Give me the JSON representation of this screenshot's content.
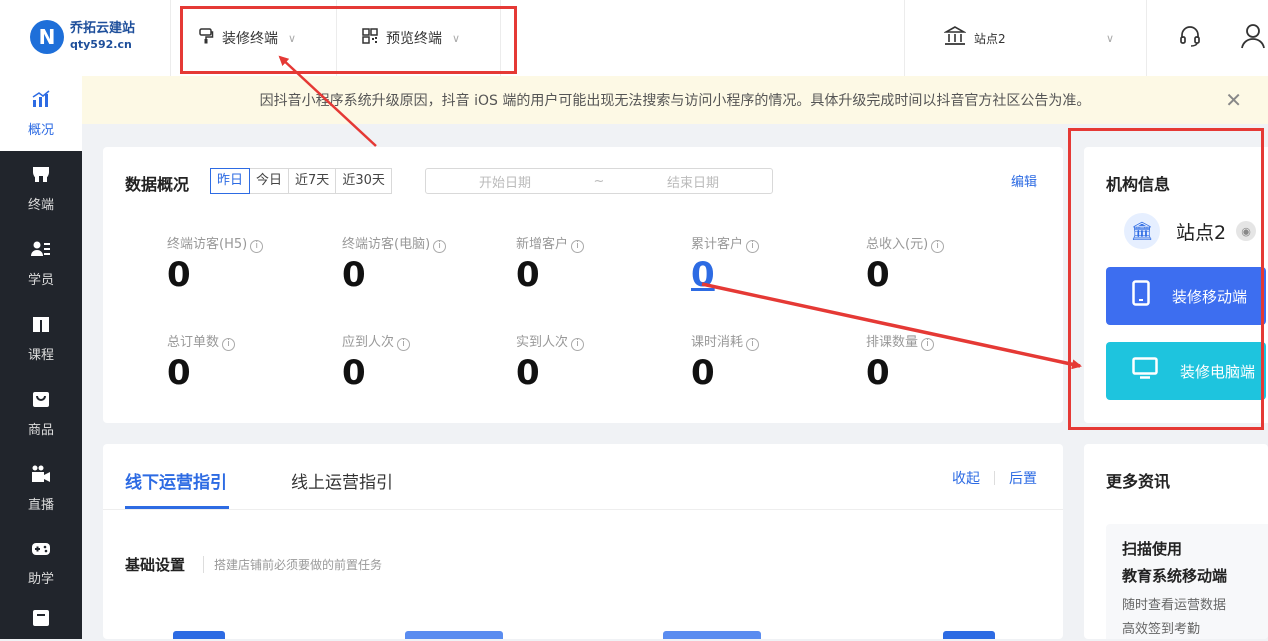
{
  "brand": {
    "name": "乔拓云建站",
    "domain": "qty592.cn"
  },
  "topnav": {
    "decorate_terminal": "装修终端",
    "preview_terminal": "预览终端",
    "site_selector": "站点2"
  },
  "sidebar": {
    "items": [
      {
        "label": "概况",
        "icon": "chart-icon"
      },
      {
        "label": "终端",
        "icon": "store-icon"
      },
      {
        "label": "学员",
        "icon": "students-icon"
      },
      {
        "label": "课程",
        "icon": "book-icon"
      },
      {
        "label": "商品",
        "icon": "bag-icon"
      },
      {
        "label": "直播",
        "icon": "video-icon"
      },
      {
        "label": "助学",
        "icon": "gamepad-icon"
      }
    ]
  },
  "notice": {
    "text": "因抖音小程序系统升级原因，抖音 iOS 端的用户可能出现无法搜索与访问小程序的情况。具体升级完成时间以抖音官方社区公告为准。"
  },
  "overview": {
    "title": "数据概况",
    "tabs": [
      "昨日",
      "今日",
      "近7天",
      "近30天"
    ],
    "active_tab": "昨日",
    "start_placeholder": "开始日期",
    "tilde": "~",
    "end_placeholder": "结束日期",
    "edit": "编辑",
    "metrics": [
      {
        "label": "终端访客(H5)",
        "value": "0"
      },
      {
        "label": "终端访客(电脑)",
        "value": "0"
      },
      {
        "label": "新增客户",
        "value": "0"
      },
      {
        "label": "累计客户",
        "value": "0"
      },
      {
        "label": "总收入(元)",
        "value": "0"
      },
      {
        "label": "总订单数",
        "value": "0"
      },
      {
        "label": "应到人次",
        "value": "0"
      },
      {
        "label": "实到人次",
        "value": "0"
      },
      {
        "label": "课时消耗",
        "value": "0"
      },
      {
        "label": "排课数量",
        "value": "0"
      }
    ]
  },
  "guide": {
    "tab_offline": "线下运营指引",
    "tab_online": "线上运营指引",
    "collapse": "收起",
    "move_back": "后置",
    "basic_title": "基础设置",
    "basic_desc": "搭建店铺前必须要做的前置任务"
  },
  "org": {
    "title": "机构信息",
    "name": "站点2",
    "mobile_btn": "装修移动端",
    "pc_btn": "装修电脑端"
  },
  "more": {
    "title": "更多资讯",
    "headline_1": "扫描使用",
    "headline_2": "教育系统移动端",
    "desc_1": "随时查看运营数据",
    "desc_2": "高效签到考勤"
  },
  "colors": {
    "accent": "#2d6be3",
    "mobile_btn": "#3d6ef0",
    "pc_btn": "#1ec4de",
    "annotation": "#e53935"
  }
}
